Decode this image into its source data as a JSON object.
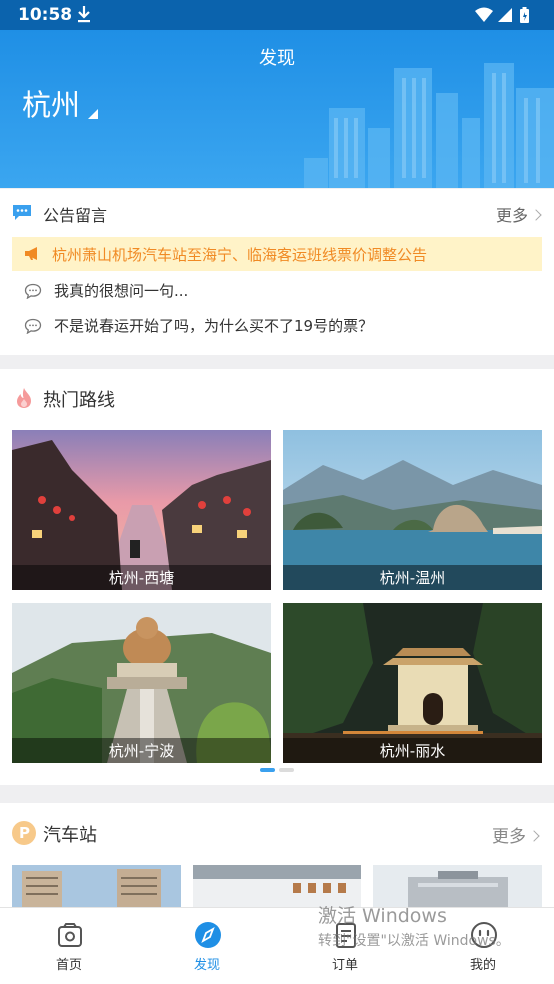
{
  "status_bar": {
    "time": "10:58"
  },
  "header": {
    "title": "发现",
    "city": "杭州"
  },
  "notice": {
    "title": "公告留言",
    "more": "更多",
    "announcement": "杭州萧山机场汽车站至海宁、临海客运班线票价调整公告",
    "messages": [
      "我真的很想问一句...",
      "不是说春运开始了吗，为什么买不了19号的票？"
    ]
  },
  "routes": {
    "title": "热门路线",
    "items": [
      {
        "label": "杭州-西塘"
      },
      {
        "label": "杭州-温州"
      },
      {
        "label": "杭州-宁波"
      },
      {
        "label": "杭州-丽水"
      }
    ],
    "pager": {
      "count": 2,
      "active": 0
    }
  },
  "stations": {
    "title": "汽车站",
    "more": "更多"
  },
  "bottom_nav": [
    {
      "label": "首页",
      "icon": "home-icon"
    },
    {
      "label": "发现",
      "icon": "compass-icon",
      "active": true
    },
    {
      "label": "订单",
      "icon": "order-icon"
    },
    {
      "label": "我的",
      "icon": "profile-icon"
    }
  ],
  "watermark": {
    "line1": "激活 Windows",
    "line2": "转到\"设置\"以激活 Windows。"
  },
  "colors": {
    "brand": "#1f8fe5",
    "announce_text": "#f08a24",
    "announce_bg": "#fff3c8"
  }
}
